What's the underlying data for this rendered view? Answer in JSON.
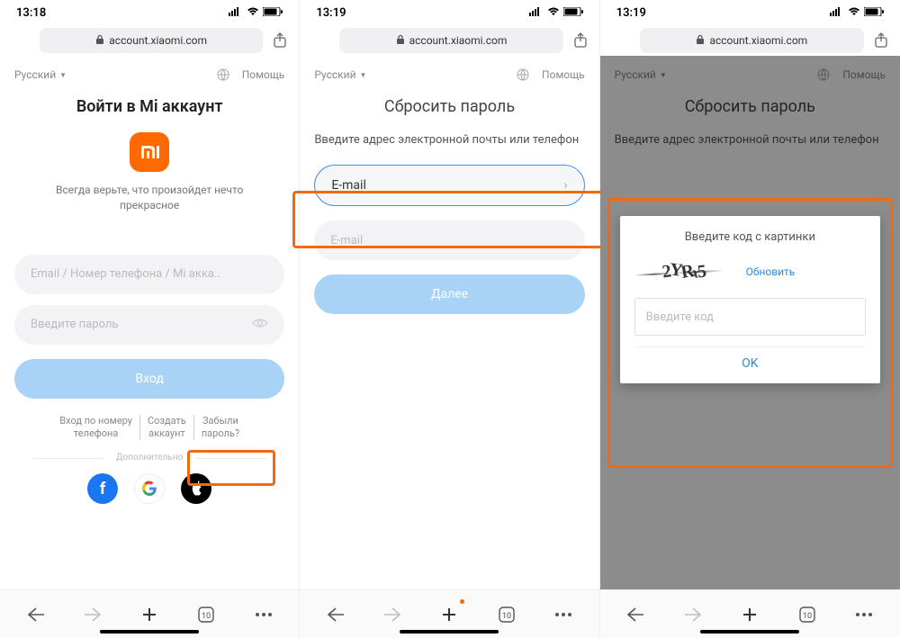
{
  "status": {
    "time1": "13:18",
    "time2": "13:19",
    "time3": "13:19"
  },
  "url": "account.xiaomi.com",
  "top": {
    "language": "Русский",
    "help": "Помощь"
  },
  "screen1": {
    "title": "Войти в Mi аккаунт",
    "slogan_l1": "Всегда верьте, что произойдет нечто",
    "slogan_l2": "прекрасное",
    "input_login": "Email / Номер телефона / Mi акка..",
    "input_password": "Введите пароль",
    "login_btn": "Вход",
    "link_phone_l1": "Вход по номеру",
    "link_phone_l2": "телефона",
    "link_create_l1": "Создать",
    "link_create_l2": "аккаунт",
    "link_forgot_l1": "Забыли",
    "link_forgot_l2": "пароль?",
    "more_label": "Дополнительно"
  },
  "screen2": {
    "title": "Сбросить пароль",
    "subtitle": "Введите адрес электронной почты или телефон",
    "selector_label": "E-mail",
    "input_placeholder": "E-mail",
    "next_btn": "Далее"
  },
  "screen3": {
    "title": "Сбросить пароль",
    "subtitle": "Введите адрес электронной почты или телефон",
    "modal_title": "Введите код с картинки",
    "captcha_text": "2YRx5",
    "refresh": "Обновить",
    "input_placeholder": "Введите код",
    "ok": "OK"
  },
  "nav": {
    "tabs_count": "10"
  }
}
